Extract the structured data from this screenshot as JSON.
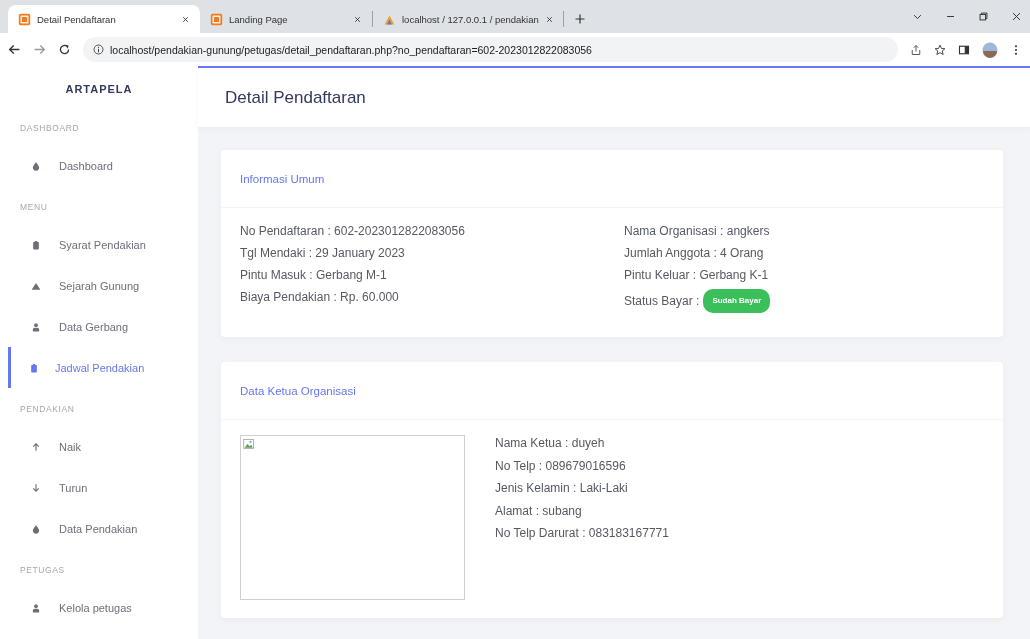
{
  "browser": {
    "tabs": [
      {
        "title": "Detail Pendaftaran",
        "kind": "xampp",
        "selected": true
      },
      {
        "title": "Landing Page",
        "kind": "xampp",
        "selected": false
      },
      {
        "title": "localhost / 127.0.0.1 / pendakian",
        "kind": "sail",
        "selected": false
      }
    ],
    "url": "localhost/pendakian-gunung/petugas/detail_pendaftaran.php?no_pendaftaran=602-2023012822083056"
  },
  "sidebar": {
    "brand": "ARTAPELA",
    "sections": [
      {
        "heading": "DASHBOARD",
        "items": [
          {
            "label": "Dashboard",
            "kind": "drop",
            "selected": false
          }
        ]
      },
      {
        "heading": "MENU",
        "items": [
          {
            "label": "Syarat Pendakian",
            "kind": "clipboard",
            "selected": false
          },
          {
            "label": "Sejarah Gunung",
            "kind": "mountain",
            "selected": false
          },
          {
            "label": "Data Gerbang",
            "kind": "user",
            "selected": false
          },
          {
            "label": "Jadwal Pendakian",
            "kind": "clipboard",
            "selected": true
          }
        ]
      },
      {
        "heading": "PENDAKIAN",
        "items": [
          {
            "label": "Naik",
            "kind": "up",
            "selected": false
          },
          {
            "label": "Turun",
            "kind": "down",
            "selected": false
          },
          {
            "label": "Data Pendakian",
            "kind": "drop",
            "selected": false
          }
        ]
      },
      {
        "heading": "PETUGAS",
        "items": [
          {
            "label": "Kelola petugas",
            "kind": "user",
            "selected": false
          }
        ]
      }
    ]
  },
  "page": {
    "title": "Detail Pendaftaran",
    "general": {
      "title": "Informasi Umum",
      "left": [
        "No Pendaftaran : 602-2023012822083056",
        "Tgl Mendaki : 29 January 2023",
        "Pintu Masuk : Gerbang M-1",
        "Biaya Pendakian : Rp. 60.000"
      ],
      "right": [
        "Nama Organisasi : angkers",
        "Jumlah Anggota : 4 Orang",
        "Pintu Keluar : Gerbang K-1"
      ],
      "status": {
        "label": "Status Bayar :",
        "badge": "Sudah Bayar",
        "color": "#3bbf5b"
      }
    },
    "leader": {
      "title": "Data Ketua Organisasi",
      "details": [
        "Nama Ketua : duyeh",
        "No Telp : 089679016596",
        "Jenis Kelamin : Laki-Laki",
        "Alamat : subang",
        "No Telp Darurat : 083183167771"
      ]
    }
  }
}
